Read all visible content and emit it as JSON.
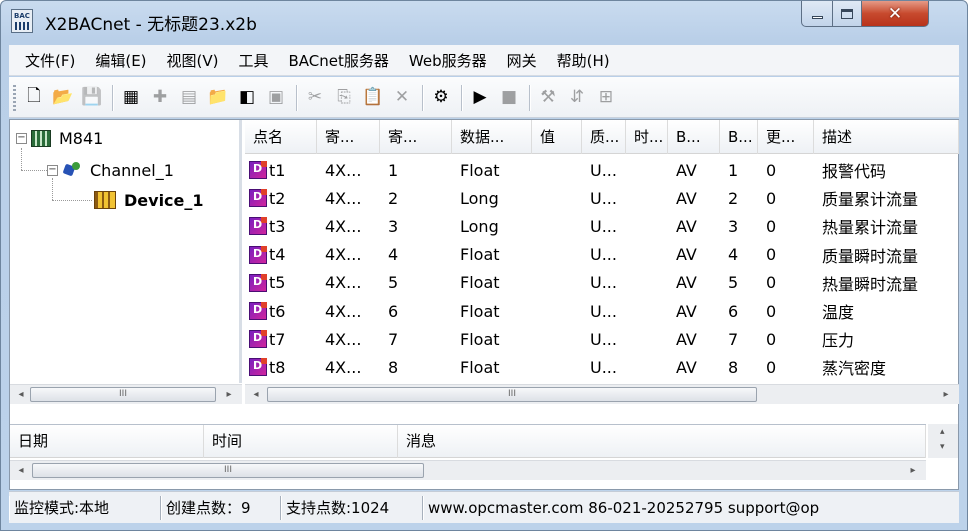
{
  "window": {
    "app_icon_text": "BAC",
    "title": "X2BACnet - 无标题23.x2b"
  },
  "menu": [
    "文件(F)",
    "编辑(E)",
    "视图(V)",
    "工具",
    "BACnet服务器",
    "Web服务器",
    "网关",
    "帮助(H)"
  ],
  "toolbar": {
    "buttons": [
      {
        "icon": "new-file-icon",
        "glyph": "🗋",
        "enabled": true
      },
      {
        "icon": "open-folder-icon",
        "glyph": "📂",
        "enabled": true
      },
      {
        "icon": "save-icon",
        "glyph": "💾",
        "enabled": false
      },
      {
        "icon": "add-device-icon",
        "glyph": "▦",
        "enabled": true
      },
      {
        "icon": "add-channel-icon",
        "glyph": "✚",
        "enabled": false
      },
      {
        "icon": "device-list-icon",
        "glyph": "▤",
        "enabled": false
      },
      {
        "icon": "new-folder-icon",
        "glyph": "📁",
        "enabled": true
      },
      {
        "icon": "add-point-icon",
        "glyph": "◧",
        "enabled": true
      },
      {
        "icon": "properties-icon",
        "glyph": "▣",
        "enabled": false
      },
      {
        "icon": "cut-icon",
        "glyph": "✂",
        "enabled": false
      },
      {
        "icon": "copy-icon",
        "glyph": "⎘",
        "enabled": false
      },
      {
        "icon": "paste-icon",
        "glyph": "📋",
        "enabled": true
      },
      {
        "icon": "delete-icon",
        "glyph": "✕",
        "enabled": false
      },
      {
        "icon": "monitor-icon",
        "glyph": "⚙",
        "enabled": true
      },
      {
        "icon": "run-icon",
        "glyph": "▶",
        "enabled": true
      },
      {
        "icon": "stop-icon",
        "glyph": "■",
        "enabled": false
      },
      {
        "icon": "tools-icon",
        "glyph": "⚒",
        "enabled": false
      },
      {
        "icon": "load-icon",
        "glyph": "⇵",
        "enabled": false
      },
      {
        "icon": "network-icon",
        "glyph": "⊞",
        "enabled": false
      }
    ],
    "separators_after": [
      2,
      8,
      12,
      13,
      15
    ]
  },
  "tree": {
    "root": "M841",
    "channel": "Channel_1",
    "device": "Device_1"
  },
  "grid": {
    "columns": [
      {
        "label": "点名",
        "width": 72
      },
      {
        "label": "寄...",
        "width": 63
      },
      {
        "label": "寄...",
        "width": 72
      },
      {
        "label": "数据...",
        "width": 80
      },
      {
        "label": "值",
        "width": 50
      },
      {
        "label": "质...",
        "width": 44
      },
      {
        "label": "时...",
        "width": 42
      },
      {
        "label": "B...",
        "width": 52
      },
      {
        "label": "B...",
        "width": 38
      },
      {
        "label": "更...",
        "width": 56
      },
      {
        "label": "描述",
        "width": 145
      }
    ],
    "rows": [
      [
        "t1",
        "4X...",
        "1",
        "Float",
        "",
        "U...",
        "",
        "AV",
        "1",
        "0",
        "报警代码"
      ],
      [
        "t2",
        "4X...",
        "2",
        "Long",
        "",
        "U...",
        "",
        "AV",
        "2",
        "0",
        "质量累计流量"
      ],
      [
        "t3",
        "4X...",
        "3",
        "Long",
        "",
        "U...",
        "",
        "AV",
        "3",
        "0",
        "热量累计流量"
      ],
      [
        "t4",
        "4X...",
        "4",
        "Float",
        "",
        "U...",
        "",
        "AV",
        "4",
        "0",
        "质量瞬时流量"
      ],
      [
        "t5",
        "4X...",
        "5",
        "Float",
        "",
        "U...",
        "",
        "AV",
        "5",
        "0",
        "热量瞬时流量"
      ],
      [
        "t6",
        "4X...",
        "6",
        "Float",
        "",
        "U...",
        "",
        "AV",
        "6",
        "0",
        "温度"
      ],
      [
        "t7",
        "4X...",
        "7",
        "Float",
        "",
        "U...",
        "",
        "AV",
        "7",
        "0",
        "压力"
      ],
      [
        "t8",
        "4X...",
        "8",
        "Float",
        "",
        "U...",
        "",
        "AV",
        "8",
        "0",
        "蒸汽密度"
      ]
    ]
  },
  "log": {
    "columns": [
      "日期",
      "时间",
      "消息"
    ]
  },
  "scroll": {
    "arrow_left": "◂",
    "arrow_right": "▸",
    "arrow_up": "▴",
    "arrow_down": "▾",
    "thumb_grip": "III"
  },
  "status": {
    "mode": "监控模式:本地",
    "created": "创建点数：9",
    "supported": "支持点数:1024",
    "contact": "www.opcmaster.com 86-021-20252795 support@op"
  }
}
